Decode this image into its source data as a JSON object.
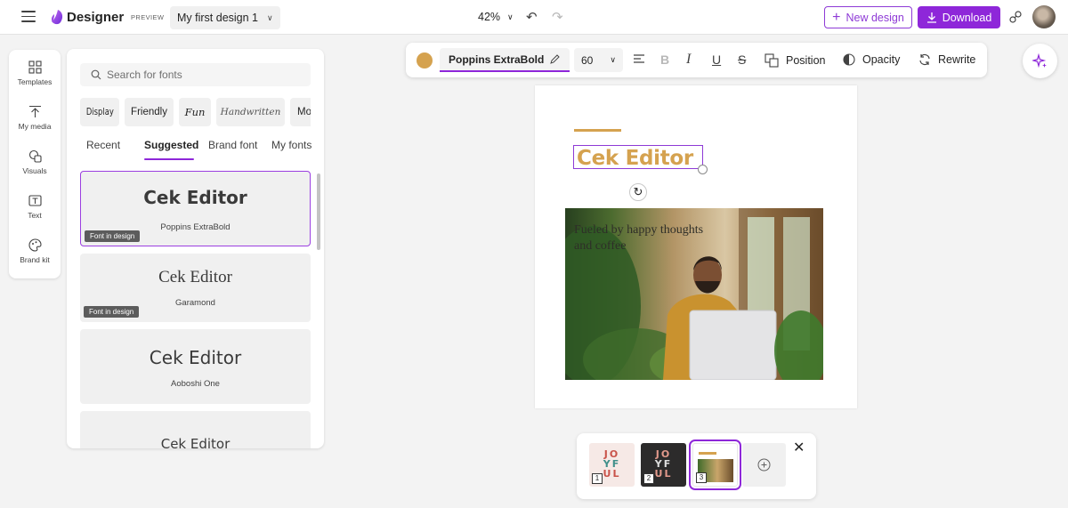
{
  "app": {
    "name": "Designer",
    "preview_tag": "PREVIEW",
    "design_name": "My first design 1",
    "zoom": "42%"
  },
  "header": {
    "new_design_label": "New design",
    "download_label": "Download"
  },
  "rail": {
    "items": [
      {
        "label": "Templates",
        "icon": "templates-icon"
      },
      {
        "label": "My media",
        "icon": "upload-icon"
      },
      {
        "label": "Visuals",
        "icon": "shapes-icon"
      },
      {
        "label": "Text",
        "icon": "text-icon"
      },
      {
        "label": "Brand kit",
        "icon": "palette-icon"
      }
    ]
  },
  "panel": {
    "search_placeholder": "Search for fonts",
    "chips": [
      "Display",
      "Friendly",
      "Fun",
      "Handwritten",
      "Mo"
    ],
    "tabs": [
      "Recent",
      "Suggested",
      "Brand font",
      "My fonts"
    ],
    "active_tab": "Suggested",
    "fonts": [
      {
        "sample": "Cek Editor",
        "name": "Poppins ExtraBold",
        "badge": "Font in design",
        "selected": true
      },
      {
        "sample": "Cek Editor",
        "name": "Garamond",
        "badge": "Font in design",
        "selected": false
      },
      {
        "sample": "Cek Editor",
        "name": "Aoboshi One",
        "badge": "",
        "selected": false
      },
      {
        "sample": "Cek Editor",
        "name": "",
        "badge": "",
        "selected": false
      }
    ]
  },
  "toolbar": {
    "color": "#d5a24f",
    "font_name": "Poppins ExtraBold",
    "font_size": "60",
    "position_label": "Position",
    "opacity_label": "Opacity",
    "rewrite_label": "Rewrite"
  },
  "canvas": {
    "title": "Cek Editor",
    "title_color": "#d5a24f",
    "photo_caption": "Fueled by happy thoughts and coffee"
  },
  "pages": {
    "items": [
      {
        "number": "1",
        "bg": "#f6e9e6",
        "text": [
          "JO",
          "YF",
          "UL"
        ],
        "selected": false
      },
      {
        "number": "2",
        "bg": "#2c2b2b",
        "text": [
          "JO",
          "YF",
          "UL"
        ],
        "selected": false
      },
      {
        "number": "3",
        "bg": "#ffffff",
        "text": [],
        "selected": true
      }
    ]
  },
  "colors": {
    "accent": "#8e27d9",
    "title_gold": "#d5a24f"
  }
}
